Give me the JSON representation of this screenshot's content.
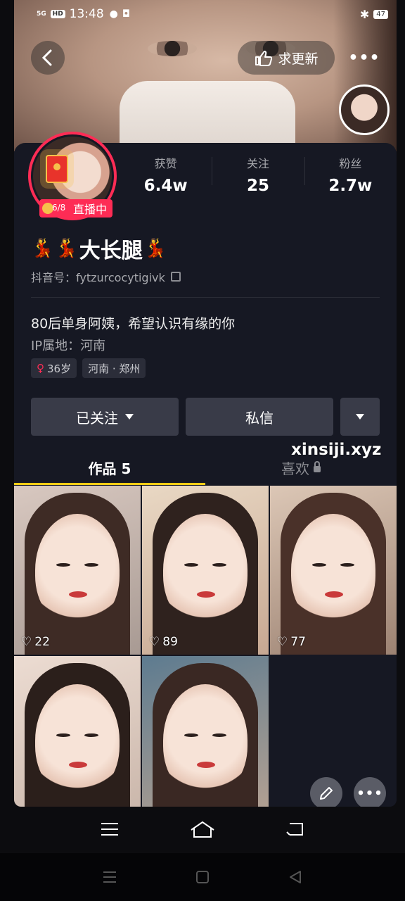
{
  "status_bar": {
    "network": "5G",
    "hd": "HD",
    "time": "13:48",
    "battery": "47"
  },
  "header": {
    "update_label": "求更新"
  },
  "profile": {
    "live_label": "直播中",
    "live_counter": "6/8",
    "stats": [
      {
        "label": "获赞",
        "value": "6.4w"
      },
      {
        "label": "关注",
        "value": "25"
      },
      {
        "label": "粉丝",
        "value": "2.7w"
      }
    ],
    "name": "大长腿",
    "douyin_id": "抖音号：fytzurcocytigivk",
    "bio": "80后单身阿姨，希望认识有缘的你",
    "ip": "IP属地：河南",
    "tags": {
      "age": "36岁",
      "location": "河南 · 郑州"
    }
  },
  "actions": {
    "follow": "已关注",
    "message": "私信"
  },
  "watermark": "xinsiji.xyz",
  "tabs": [
    {
      "label": "作品 5"
    },
    {
      "label": "喜欢"
    }
  ],
  "videos": [
    {
      "likes": "22"
    },
    {
      "likes": "89"
    },
    {
      "likes": "77"
    }
  ],
  "colors": {
    "accent": "#fe2c55",
    "tab_indicator": "#facc15",
    "background": "#161823"
  }
}
